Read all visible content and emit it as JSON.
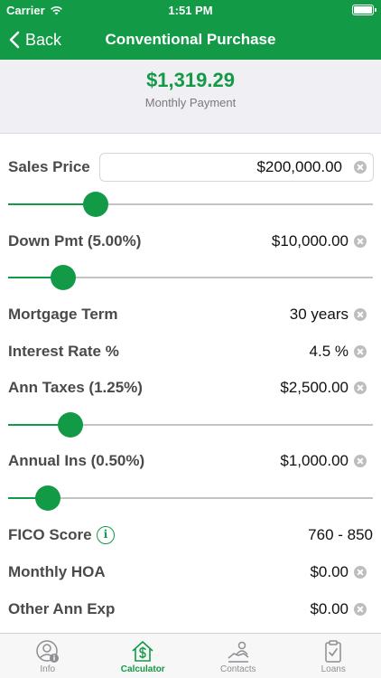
{
  "status_bar": {
    "carrier": "Carrier",
    "time": "1:51 PM"
  },
  "nav": {
    "back_label": "Back",
    "title": "Conventional Purchase"
  },
  "summary": {
    "amount": "$1,319.29",
    "label": "Monthly Payment"
  },
  "fields": {
    "sales_price": {
      "label": "Sales Price",
      "value": "$200,000.00",
      "slider_fraction": 0.24
    },
    "down_pmt": {
      "label": "Down Pmt (5.00%)",
      "value": "$10,000.00",
      "slider_fraction": 0.15
    },
    "mortgage_term": {
      "label": "Mortgage Term",
      "value": "30 years"
    },
    "interest_rate": {
      "label": "Interest Rate %",
      "value": "4.5 %"
    },
    "ann_taxes": {
      "label": "Ann Taxes (1.25%)",
      "value": "$2,500.00",
      "slider_fraction": 0.17
    },
    "annual_ins": {
      "label": "Annual Ins (0.50%)",
      "value": "$1,000.00",
      "slider_fraction": 0.11
    },
    "fico_score": {
      "label": "FICO Score",
      "value": "760 - 850",
      "info_glyph": "i"
    },
    "monthly_hoa": {
      "label": "Monthly HOA",
      "value": "$0.00"
    },
    "other_ann_exp": {
      "label": "Other Ann Exp",
      "value": "$0.00"
    }
  },
  "tabs": [
    {
      "label": "Info",
      "icon": "user-info-icon",
      "active": false
    },
    {
      "label": "Calculator",
      "icon": "house-dollar-icon",
      "active": true
    },
    {
      "label": "Contacts",
      "icon": "contacts-icon",
      "active": false
    },
    {
      "label": "Loans",
      "icon": "clipboard-check-icon",
      "active": false
    }
  ],
  "colors": {
    "brand": "#139a46",
    "inactive": "#8e8e93"
  }
}
